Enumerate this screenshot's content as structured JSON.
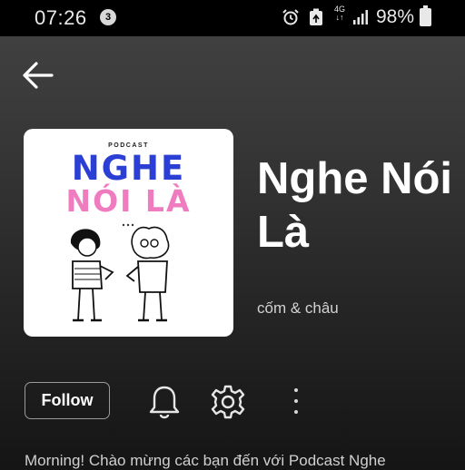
{
  "status_bar": {
    "time": "07:26",
    "notification_count": "3",
    "network_label": "4G",
    "battery_percent": "98%"
  },
  "header": {
    "back_icon": "arrow-left-icon"
  },
  "podcast": {
    "cover": {
      "kicker": "PODCAST",
      "title_line1": "NGHE",
      "title_line2": "NÓI LÀ"
    },
    "title": "Nghe Nói Là",
    "author": "cốm & châu",
    "description": "Morning! Chào mừng các bạn đến với Podcast Nghe"
  },
  "actions": {
    "follow_label": "Follow",
    "bell_icon": "bell-icon",
    "settings_icon": "gear-icon",
    "more_icon": "more-vertical-icon"
  },
  "colors": {
    "cover_blue": "#2b3fd4",
    "cover_pink": "#f07cc0",
    "background_top": "#404040",
    "background_bottom": "#151515"
  }
}
